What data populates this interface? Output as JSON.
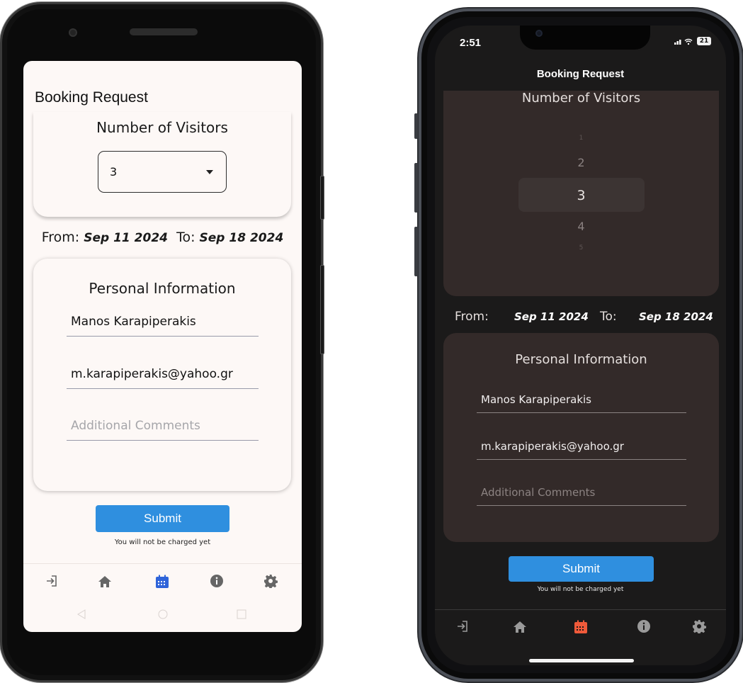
{
  "accent": "#2f8fdf",
  "active_nav_color_light": "#2f64d9",
  "active_nav_color_dark": "#f05a3a",
  "android": {
    "title": "Booking Request",
    "visitors": {
      "title": "Number of Visitors",
      "selected": "3"
    },
    "dates": {
      "from_label": "From:",
      "from": "Sep 11 2024",
      "to_label": "To:",
      "to": "Sep 18 2024"
    },
    "personal": {
      "title": "Personal Information",
      "name": "Manos Karapiperakis",
      "email": "m.karapiperakis@yahoo.gr",
      "comments_placeholder": "Additional Comments"
    },
    "submit_label": "Submit",
    "note": "You will not be charged yet",
    "nav": [
      {
        "icon": "login-icon"
      },
      {
        "icon": "home-icon"
      },
      {
        "icon": "calendar-icon",
        "active": true
      },
      {
        "icon": "info-icon"
      },
      {
        "icon": "settings-icon"
      }
    ]
  },
  "ios": {
    "time": "2:51",
    "battery": "21",
    "title": "Booking Request",
    "visitors": {
      "title": "Number of Visitors",
      "options": [
        "1",
        "2",
        "3",
        "4",
        "5"
      ],
      "selected": "3"
    },
    "dates": {
      "from_label": "From:",
      "from": "Sep 11 2024",
      "to_label": "To:",
      "to": "Sep 18 2024"
    },
    "personal": {
      "title": "Personal Information",
      "name": "Manos Karapiperakis",
      "email": "m.karapiperakis@yahoo.gr",
      "comments_placeholder": "Additional Comments"
    },
    "submit_label": "Submit",
    "note": "You will not be charged yet",
    "nav": [
      {
        "icon": "login-icon"
      },
      {
        "icon": "home-icon"
      },
      {
        "icon": "calendar-icon",
        "active": true
      },
      {
        "icon": "info-icon"
      },
      {
        "icon": "settings-icon"
      }
    ]
  }
}
